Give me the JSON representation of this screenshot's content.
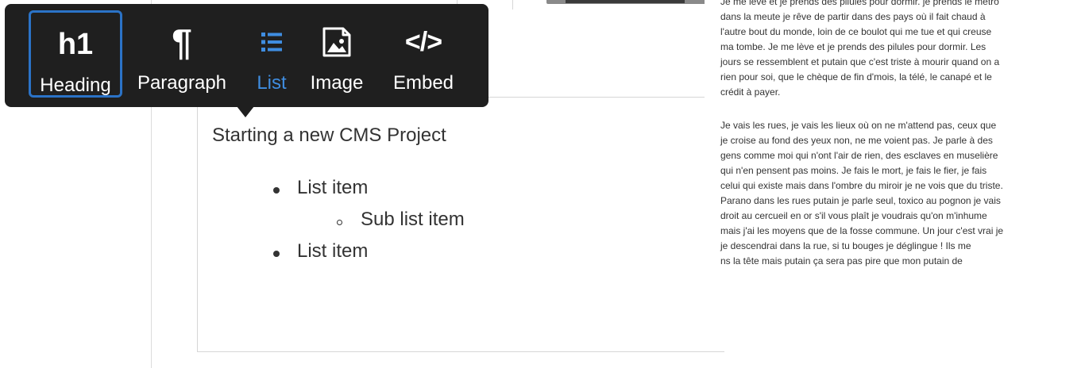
{
  "toolbar": {
    "tools": [
      {
        "glyph": "h1",
        "label": "Heading",
        "icon": "heading-icon",
        "active": true
      },
      {
        "glyph": "¶",
        "label": "Paragraph",
        "icon": "pilcrow-icon",
        "active": false
      },
      {
        "glyph": "",
        "label": "List",
        "icon": "list-icon",
        "active": false,
        "highlighted": true
      },
      {
        "glyph": "",
        "label": "Image",
        "icon": "image-icon",
        "active": false
      },
      {
        "glyph": "</>",
        "label": "Embed",
        "icon": "code-icon",
        "active": false
      }
    ],
    "highlight_color": "#3f8de0",
    "active_border_color": "#2b73c7"
  },
  "editor": {
    "title": "Starting a new CMS Project",
    "list": [
      {
        "level": 1,
        "text": "List item"
      },
      {
        "level": 2,
        "text": "Sub list item"
      },
      {
        "level": 1,
        "text": "List item"
      }
    ]
  },
  "right_text": {
    "paragraph_1": [
      "Je me lève et je prends des pilules pour dormir. je prends le métro",
      "dans la meute je rêve de partir dans des pays où il fait chaud à",
      "l'autre bout du monde, loin de ce boulot qui me tue et qui creuse",
      "ma tombe. Je me lève et je prends des pilules pour dormir. Les",
      "jours se ressemblent et putain que c'est triste à mourir quand on a",
      "rien pour soi, que le chèque de fin d'mois, la télé, le canapé et le",
      "crédit à payer."
    ],
    "paragraph_2": [
      "Je vais les rues, je vais les lieux où on ne m'attend pas, ceux que",
      "je croise au fond des yeux non, ne me voient pas. Je parle à des",
      "gens comme moi qui n'ont l'air de rien, des esclaves en muselière",
      "qui n'en pensent pas moins. Je fais le mort, je fais le fier, je fais",
      "celui qui existe mais dans l'ombre du miroir je ne vois que du triste.",
      "Parano dans les rues putain je parle seul, toxico au pognon je vais",
      "droit au cercueil en or s'il vous plaît je voudrais qu'on m'inhume",
      "mais j'ai les moyens que de la fosse commune. Un jour c'est vrai je",
      "je descendrai dans la rue, si tu bouges je déglingue ! Ils me",
      "ns la tête mais putain ça sera pas pire que mon putain de"
    ]
  }
}
